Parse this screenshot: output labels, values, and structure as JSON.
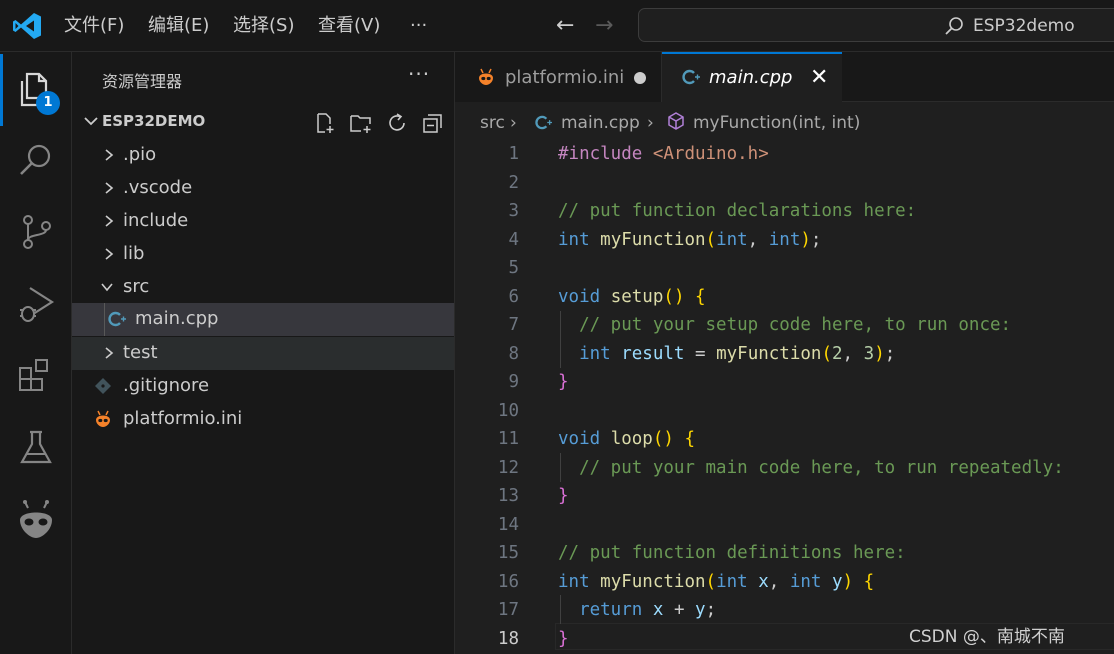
{
  "menu": [
    "文件(F)",
    "编辑(E)",
    "选择(S)",
    "查看(V)",
    "···"
  ],
  "search": {
    "label": "ESP32demo"
  },
  "activity": {
    "badge": "1"
  },
  "sidebar": {
    "title": "资源管理器",
    "more": "···",
    "project": "ESP32DEMO",
    "items": [
      {
        "label": ".pio"
      },
      {
        "label": ".vscode"
      },
      {
        "label": "include"
      },
      {
        "label": "lib"
      },
      {
        "label": "src"
      },
      {
        "label": "main.cpp"
      },
      {
        "label": "test"
      },
      {
        "label": ".gitignore"
      },
      {
        "label": "platformio.ini"
      }
    ]
  },
  "tabs": [
    {
      "label": "platformio.ini"
    },
    {
      "label": "main.cpp",
      "close": "✕"
    }
  ],
  "breadcrumb": {
    "folder": "src",
    "file": "main.cpp",
    "symbol": "myFunction(int, int)"
  },
  "editor": {
    "line_numbers": [
      "1",
      "2",
      "3",
      "4",
      "5",
      "6",
      "7",
      "8",
      "9",
      "10",
      "11",
      "12",
      "13",
      "14",
      "15",
      "16",
      "17",
      "18"
    ],
    "active_line": "18",
    "lines": [
      "#include <Arduino.h>",
      "",
      "// put function declarations here:",
      "int myFunction(int, int);",
      "",
      "void setup() {",
      "  // put your setup code here, to run once:",
      "  int result = myFunction(2, 3);",
      "}",
      "",
      "void loop() {",
      "  // put your main code here, to run repeatedly:",
      "}",
      "",
      "// put function definitions here:",
      "int myFunction(int x, int y) {",
      "  return x + y;",
      "}"
    ]
  },
  "watermark": "CSDN @、南城不南",
  "colors": {
    "accent": "#0078d4",
    "keyword": "#569cd6",
    "comment": "#6a9955",
    "function": "#dcdcaa",
    "string": "#ce9178",
    "preprocessor": "#c586c0",
    "number": "#b5cea8",
    "variable": "#9cdcfe",
    "bracket": "#ffd700",
    "platformio": "#f5822a"
  }
}
